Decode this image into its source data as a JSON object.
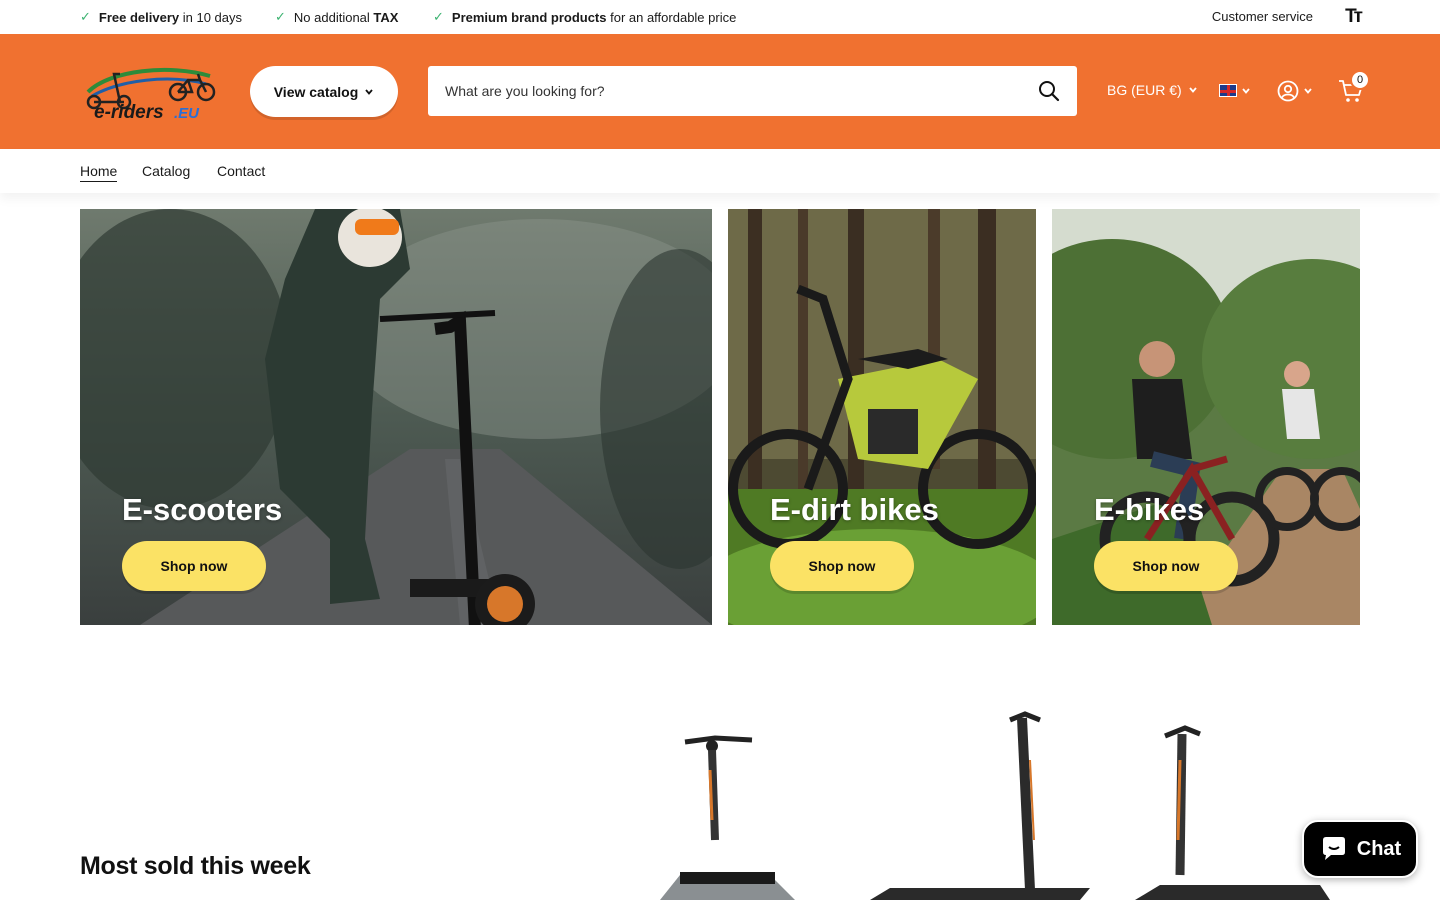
{
  "usp": {
    "items": [
      {
        "bold": "Free delivery",
        "rest": " in 10 days"
      },
      {
        "pre": "No additional ",
        "bold": "TAX"
      },
      {
        "bold": "Premium brand products",
        "rest": " for an affordable price"
      }
    ],
    "customer_service": "Customer service",
    "text_size_icon": "Tт"
  },
  "header": {
    "logo_alt": "e-riders.EU",
    "view_catalog_label": "View catalog",
    "search_placeholder": "What are you looking for?",
    "currency": "BG (EUR €)",
    "language_flag": "uk-flag-icon",
    "cart_count": "0",
    "colors": {
      "brand": "#f07130",
      "button_yellow": "#fbe265"
    }
  },
  "nav": {
    "items": [
      "Home",
      "Catalog",
      "Contact"
    ]
  },
  "tiles": [
    {
      "title": "E-scooters",
      "button": "Shop now"
    },
    {
      "title": "E-dirt bikes",
      "button": "Shop now"
    },
    {
      "title": "E-bikes",
      "button": "Shop now"
    }
  ],
  "sections": {
    "most_sold_title": "Most sold this week"
  },
  "chat": {
    "label": "Chat"
  }
}
